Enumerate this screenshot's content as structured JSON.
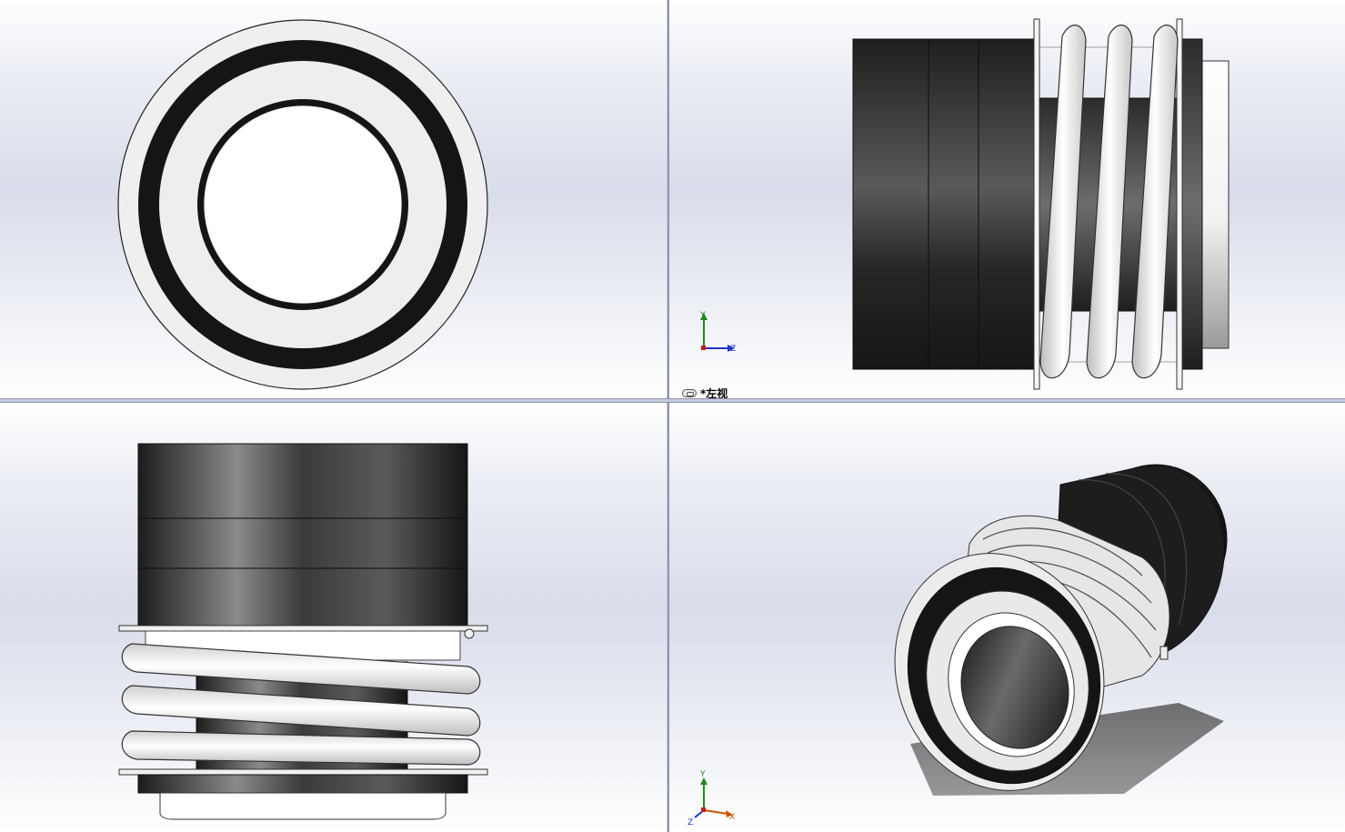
{
  "viewports": {
    "top_left": {
      "name": "front-view"
    },
    "top_right": {
      "name": "left-view",
      "label": "*左视",
      "triad": {
        "y": "Y",
        "z": "Z"
      }
    },
    "bottom_left": {
      "name": "top-view"
    },
    "bottom_right": {
      "name": "isometric-view",
      "triad": {
        "y": "Y",
        "x": "X",
        "z": "Z"
      }
    }
  },
  "colors": {
    "dark_ring": "#141414",
    "light_face": "#efefef",
    "spring": "#f4f4f4",
    "axis_y": "#1c8a1c",
    "axis_z": "#2233cc",
    "axis_x": "#cc5500"
  }
}
